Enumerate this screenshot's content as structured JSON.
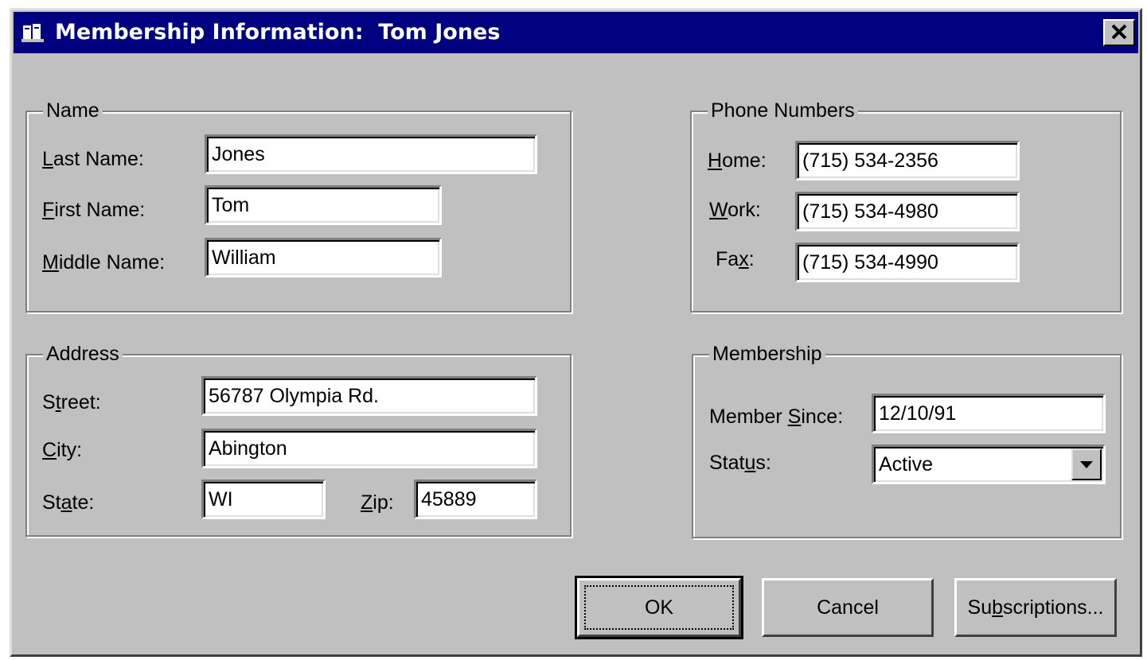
{
  "window": {
    "title": "Membership Information:  Tom Jones",
    "icon": "books-icon",
    "close": "close-icon"
  },
  "name_group": {
    "legend": "Name",
    "last_name": {
      "label_pre": "",
      "label_key": "L",
      "label_post": "ast Name:",
      "value": "Jones"
    },
    "first_name": {
      "label_pre": "",
      "label_key": "F",
      "label_post": "irst Name:",
      "value": "Tom"
    },
    "middle_name": {
      "label_pre": "",
      "label_key": "M",
      "label_post": "iddle Name:",
      "value": "William"
    }
  },
  "address_group": {
    "legend": "Address",
    "street": {
      "label_pre": "S",
      "label_key": "t",
      "label_post": "reet:",
      "value": "56787 Olympia Rd."
    },
    "city": {
      "label_pre": "",
      "label_key": "C",
      "label_post": "ity:",
      "value": "Abington"
    },
    "state": {
      "label_pre": "St",
      "label_key": "a",
      "label_post": "te:",
      "value": "WI"
    },
    "zip": {
      "label_pre": "",
      "label_key": "Z",
      "label_post": "ip:",
      "value": "45889"
    }
  },
  "phone_group": {
    "legend": "Phone Numbers",
    "home": {
      "label_pre": "",
      "label_key": "H",
      "label_post": "ome:",
      "value": "(715) 534-2356"
    },
    "work": {
      "label_pre": "",
      "label_key": "W",
      "label_post": "ork:",
      "value": "(715) 534-4980"
    },
    "fax": {
      "label_pre": "Fa",
      "label_key": "x",
      "label_post": ":",
      "value": "(715) 534-4990"
    }
  },
  "membership_group": {
    "legend": "Membership",
    "member_since": {
      "label_pre": "Member ",
      "label_key": "S",
      "label_post": "ince:",
      "value": "12/10/91"
    },
    "status": {
      "label_pre": "Stat",
      "label_key": "u",
      "label_post": "s:",
      "value": "Active"
    }
  },
  "buttons": {
    "ok": "OK",
    "cancel": "Cancel",
    "subscriptions_pre": "Su",
    "subscriptions_key": "b",
    "subscriptions_post": "scriptions..."
  },
  "colors": {
    "titlebar": "#000080",
    "face": "#c0c0c0"
  }
}
